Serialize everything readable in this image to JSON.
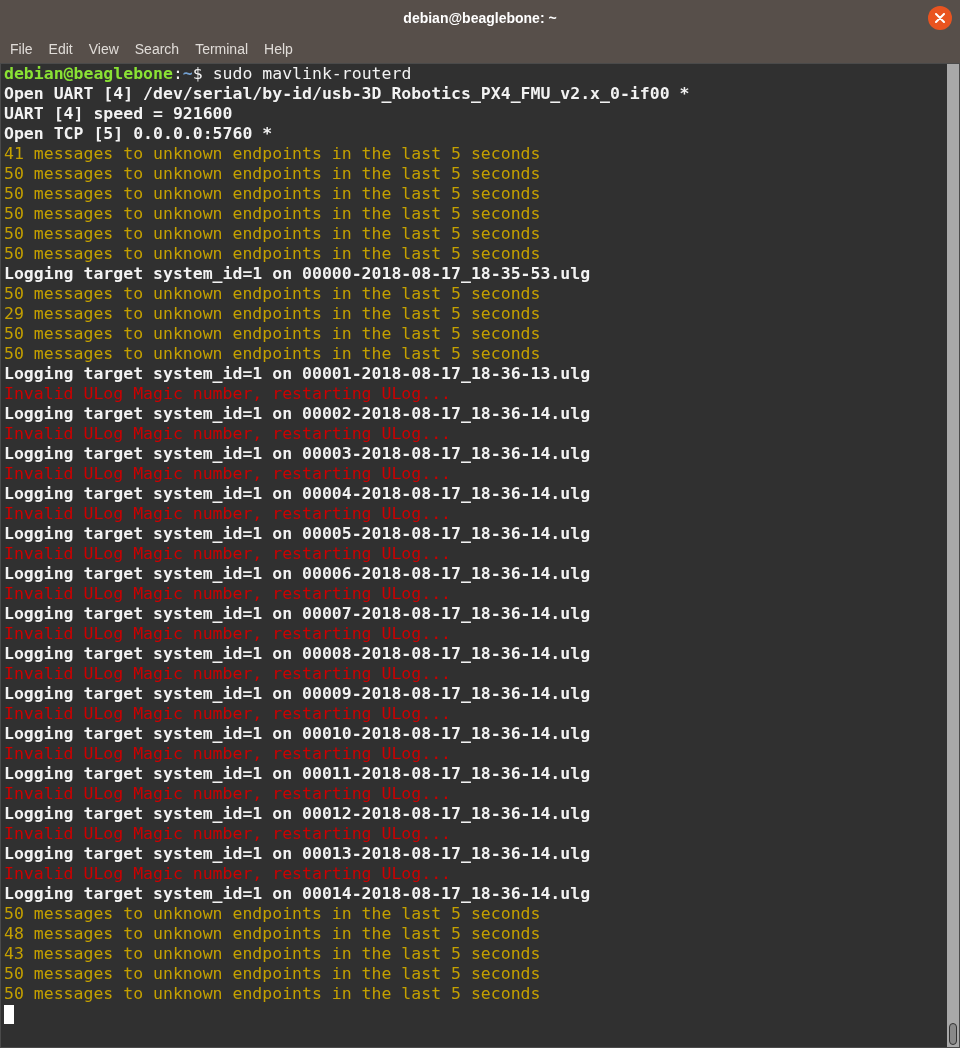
{
  "window": {
    "title": "debian@beaglebone: ~"
  },
  "menu": [
    "File",
    "Edit",
    "View",
    "Search",
    "Terminal",
    "Help"
  ],
  "terminal": {
    "lines": [
      {
        "kind": "prompt",
        "segments": [
          {
            "kind": "host",
            "text": "debian@beaglebone"
          },
          {
            "kind": "plain",
            "text": ":"
          },
          {
            "kind": "path",
            "text": "~"
          },
          {
            "kind": "plain",
            "text": "$ sudo mavlink-routerd"
          }
        ]
      },
      {
        "kind": "bold",
        "text": "Open UART [4] /dev/serial/by-id/usb-3D_Robotics_PX4_FMU_v2.x_0-if00 *"
      },
      {
        "kind": "bold",
        "text": "UART [4] speed = 921600"
      },
      {
        "kind": "bold",
        "text": "Open TCP [5] 0.0.0.0:5760 *"
      },
      {
        "kind": "warn",
        "text": "41 messages to unknown endpoints in the last 5 seconds"
      },
      {
        "kind": "warn",
        "text": "50 messages to unknown endpoints in the last 5 seconds"
      },
      {
        "kind": "warn",
        "text": "50 messages to unknown endpoints in the last 5 seconds"
      },
      {
        "kind": "warn",
        "text": "50 messages to unknown endpoints in the last 5 seconds"
      },
      {
        "kind": "warn",
        "text": "50 messages to unknown endpoints in the last 5 seconds"
      },
      {
        "kind": "warn",
        "text": "50 messages to unknown endpoints in the last 5 seconds"
      },
      {
        "kind": "bold",
        "text": "Logging target system_id=1 on 00000-2018-08-17_18-35-53.ulg"
      },
      {
        "kind": "warn",
        "text": "50 messages to unknown endpoints in the last 5 seconds"
      },
      {
        "kind": "warn",
        "text": "29 messages to unknown endpoints in the last 5 seconds"
      },
      {
        "kind": "warn",
        "text": "50 messages to unknown endpoints in the last 5 seconds"
      },
      {
        "kind": "warn",
        "text": "50 messages to unknown endpoints in the last 5 seconds"
      },
      {
        "kind": "bold",
        "text": "Logging target system_id=1 on 00001-2018-08-17_18-36-13.ulg"
      },
      {
        "kind": "error",
        "text": "Invalid ULog Magic number, restarting ULog..."
      },
      {
        "kind": "bold",
        "text": "Logging target system_id=1 on 00002-2018-08-17_18-36-14.ulg"
      },
      {
        "kind": "error",
        "text": "Invalid ULog Magic number, restarting ULog..."
      },
      {
        "kind": "bold",
        "text": "Logging target system_id=1 on 00003-2018-08-17_18-36-14.ulg"
      },
      {
        "kind": "error",
        "text": "Invalid ULog Magic number, restarting ULog..."
      },
      {
        "kind": "bold",
        "text": "Logging target system_id=1 on 00004-2018-08-17_18-36-14.ulg"
      },
      {
        "kind": "error",
        "text": "Invalid ULog Magic number, restarting ULog..."
      },
      {
        "kind": "bold",
        "text": "Logging target system_id=1 on 00005-2018-08-17_18-36-14.ulg"
      },
      {
        "kind": "error",
        "text": "Invalid ULog Magic number, restarting ULog..."
      },
      {
        "kind": "bold",
        "text": "Logging target system_id=1 on 00006-2018-08-17_18-36-14.ulg"
      },
      {
        "kind": "error",
        "text": "Invalid ULog Magic number, restarting ULog..."
      },
      {
        "kind": "bold",
        "text": "Logging target system_id=1 on 00007-2018-08-17_18-36-14.ulg"
      },
      {
        "kind": "error",
        "text": "Invalid ULog Magic number, restarting ULog..."
      },
      {
        "kind": "bold",
        "text": "Logging target system_id=1 on 00008-2018-08-17_18-36-14.ulg"
      },
      {
        "kind": "error",
        "text": "Invalid ULog Magic number, restarting ULog..."
      },
      {
        "kind": "bold",
        "text": "Logging target system_id=1 on 00009-2018-08-17_18-36-14.ulg"
      },
      {
        "kind": "error",
        "text": "Invalid ULog Magic number, restarting ULog..."
      },
      {
        "kind": "bold",
        "text": "Logging target system_id=1 on 00010-2018-08-17_18-36-14.ulg"
      },
      {
        "kind": "error",
        "text": "Invalid ULog Magic number, restarting ULog..."
      },
      {
        "kind": "bold",
        "text": "Logging target system_id=1 on 00011-2018-08-17_18-36-14.ulg"
      },
      {
        "kind": "error",
        "text": "Invalid ULog Magic number, restarting ULog..."
      },
      {
        "kind": "bold",
        "text": "Logging target system_id=1 on 00012-2018-08-17_18-36-14.ulg"
      },
      {
        "kind": "error",
        "text": "Invalid ULog Magic number, restarting ULog..."
      },
      {
        "kind": "bold",
        "text": "Logging target system_id=1 on 00013-2018-08-17_18-36-14.ulg"
      },
      {
        "kind": "error",
        "text": "Invalid ULog Magic number, restarting ULog..."
      },
      {
        "kind": "bold",
        "text": "Logging target system_id=1 on 00014-2018-08-17_18-36-14.ulg"
      },
      {
        "kind": "warn",
        "text": "50 messages to unknown endpoints in the last 5 seconds"
      },
      {
        "kind": "warn",
        "text": "48 messages to unknown endpoints in the last 5 seconds"
      },
      {
        "kind": "warn",
        "text": "43 messages to unknown endpoints in the last 5 seconds"
      },
      {
        "kind": "warn",
        "text": "50 messages to unknown endpoints in the last 5 seconds"
      },
      {
        "kind": "warn",
        "text": "50 messages to unknown endpoints in the last 5 seconds"
      }
    ]
  }
}
